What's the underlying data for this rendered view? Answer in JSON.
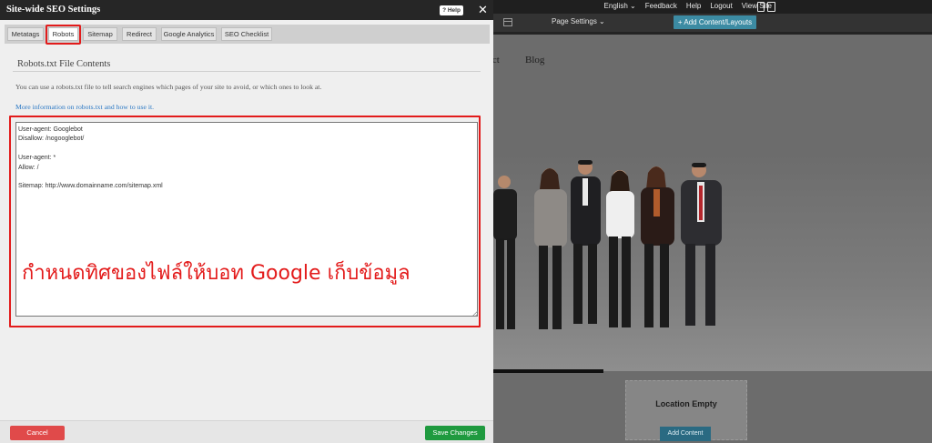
{
  "background": {
    "topbar": {
      "language": "English",
      "language_caret": "⌄",
      "links": [
        "Feedback",
        "Help",
        "Logout",
        "View Site"
      ]
    },
    "toolbar": {
      "page_settings": "Page Settings",
      "page_settings_caret": "⌄",
      "add_content": "+ Add Content/Layouts"
    },
    "site_nav": [
      "act",
      "Blog"
    ],
    "location": {
      "label": "Location Empty",
      "add_button": "Add Content"
    }
  },
  "dialog": {
    "title": "Site-wide SEO Settings",
    "help_label": "? Help",
    "close_glyph": "✕",
    "tabs": [
      {
        "label": "Metatags",
        "active": false
      },
      {
        "label": "Robots",
        "active": true
      },
      {
        "label": "Sitemap",
        "active": false
      },
      {
        "label": "Redirect",
        "active": false
      },
      {
        "label": "Google Analytics",
        "active": false
      },
      {
        "label": "SEO Checklist",
        "active": false
      }
    ],
    "section_title": "Robots.txt File Contents",
    "description": "You can use a robots.txt file to tell search engines which pages of your site to avoid, or which ones to look at.",
    "info_link": "More information on robots.txt and how to use it.",
    "robots_content": "User-agent: Googlebot\nDisallow: /nogooglebot/\n\nUser-agent: *\nAllow: /\n\nSitemap: http://www.domainname.com/sitemap.xml",
    "annotation": "กำหนดทิศของไฟล์ให้บอท Google เก็บข้อมูล",
    "cancel_label": "Cancel",
    "save_label": "Save Changes"
  },
  "colors": {
    "highlight": "#e21b1b",
    "link": "#2b78c4",
    "save": "#1f9a3f",
    "cancel": "#e04a4a",
    "accent": "#3c8ba3"
  }
}
